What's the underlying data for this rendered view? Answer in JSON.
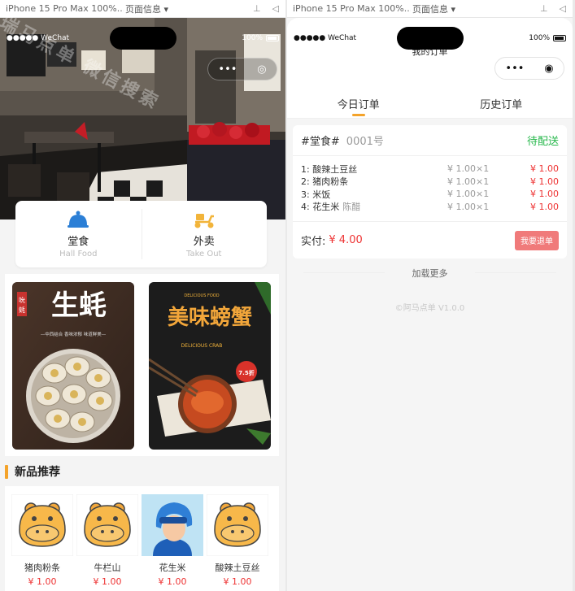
{
  "left": {
    "devtools": {
      "device": "iPhone 15 Pro Max 100%...",
      "page_info": "页面信息 ▾"
    },
    "status": {
      "carrier": "●●●●● WeChat",
      "battery": "100%"
    },
    "order_types": [
      {
        "title": "堂食",
        "subtitle": "Hall Food",
        "icon": "bell-cloche-icon"
      },
      {
        "title": "外卖",
        "subtitle": "Take Out",
        "icon": "scooter-icon"
      }
    ],
    "posters": [
      {
        "title": "生蚝",
        "tag": "吮",
        "tag2": "蚝",
        "caption": "—中西结合 香味浓郁 味道鲜美—"
      },
      {
        "title": "美味螃蟹",
        "en": "DELICIOUS FOOD",
        "en2": "DELICIOUS CRAB",
        "badge": "7.5折"
      }
    ],
    "new_products_title": "新品推荐",
    "products": [
      {
        "name": "猪肉粉条",
        "price": "¥ 1.00",
        "image": "hippo-icon"
      },
      {
        "name": "牛栏山",
        "price": "¥ 1.00",
        "image": "hippo-icon"
      },
      {
        "name": "花生米",
        "price": "¥ 1.00",
        "image": "courier-avatar-icon"
      },
      {
        "name": "酸辣土豆丝",
        "price": "¥ 1.00",
        "image": "hippo-icon"
      }
    ],
    "watermark": "瑞马点单 微信搜索"
  },
  "right": {
    "devtools": {
      "device": "iPhone 15 Pro Max 100%...",
      "page_info": "页面信息 ▾"
    },
    "status": {
      "carrier": "●●●●● WeChat",
      "battery": "100%"
    },
    "title": "我的订单",
    "tabs": [
      {
        "label": "今日订单",
        "active": true
      },
      {
        "label": "历史订单",
        "active": false
      }
    ],
    "order": {
      "table_tag": "#堂食#",
      "number": "0001号",
      "status": "待配送",
      "items": [
        {
          "name": "1: 酸辣土豆丝",
          "note": "",
          "qty": "¥ 1.00×1",
          "sum": "¥ 1.00"
        },
        {
          "name": "2: 猪肉粉条",
          "note": "",
          "qty": "¥ 1.00×1",
          "sum": "¥ 1.00"
        },
        {
          "name": "3: 米饭",
          "note": "",
          "qty": "¥ 1.00×1",
          "sum": "¥ 1.00"
        },
        {
          "name": "4: 花生米",
          "note": "陈醋",
          "qty": "¥ 1.00×1",
          "sum": "¥ 1.00"
        }
      ],
      "paid_label": "实付:",
      "paid_amount": "¥ 4.00",
      "refund_label": "我要退单"
    },
    "load_more": "加载更多",
    "copyright": "©阿马点单 V1.0.0"
  },
  "colors": {
    "accent": "#f4a32a",
    "price": "#e33333",
    "status_green": "#25b74a",
    "refund": "#f07a7a"
  }
}
